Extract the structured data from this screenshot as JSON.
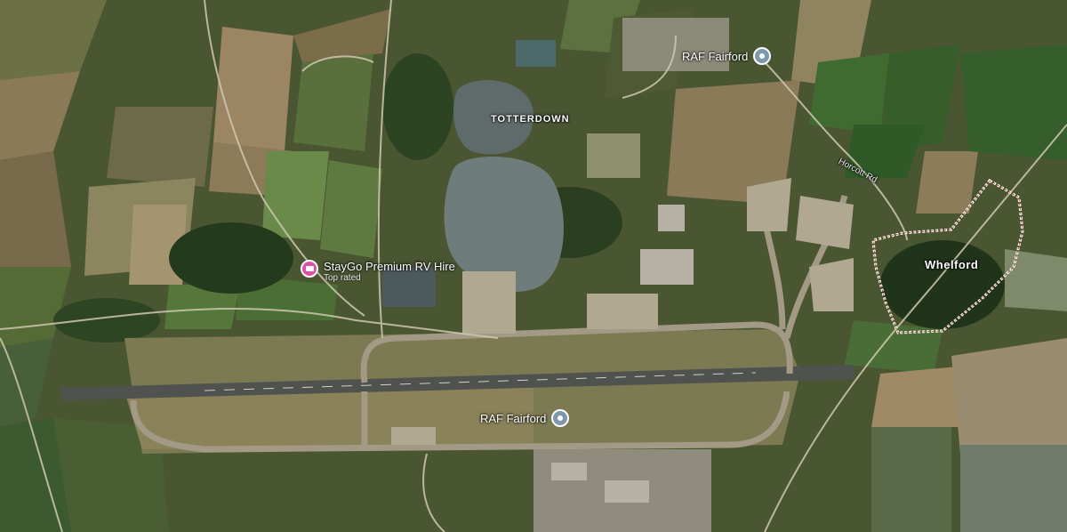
{
  "map": {
    "type": "satellite",
    "places": {
      "totterdown": "TOTTERDOWN",
      "whelford": "Whelford"
    },
    "roads": {
      "horcott": "Horcott Rd"
    },
    "pins": {
      "raf_north": "RAF Fairford",
      "raf_south": "RAF Fairford"
    },
    "poi": {
      "name": "StayGo Premium RV Hire",
      "subtitle": "Top rated",
      "color": "#e04fa6"
    },
    "colors": {
      "pin": "#7d98ad",
      "boundary": "#ffffff",
      "boundary_accent": "#c0392b"
    }
  }
}
